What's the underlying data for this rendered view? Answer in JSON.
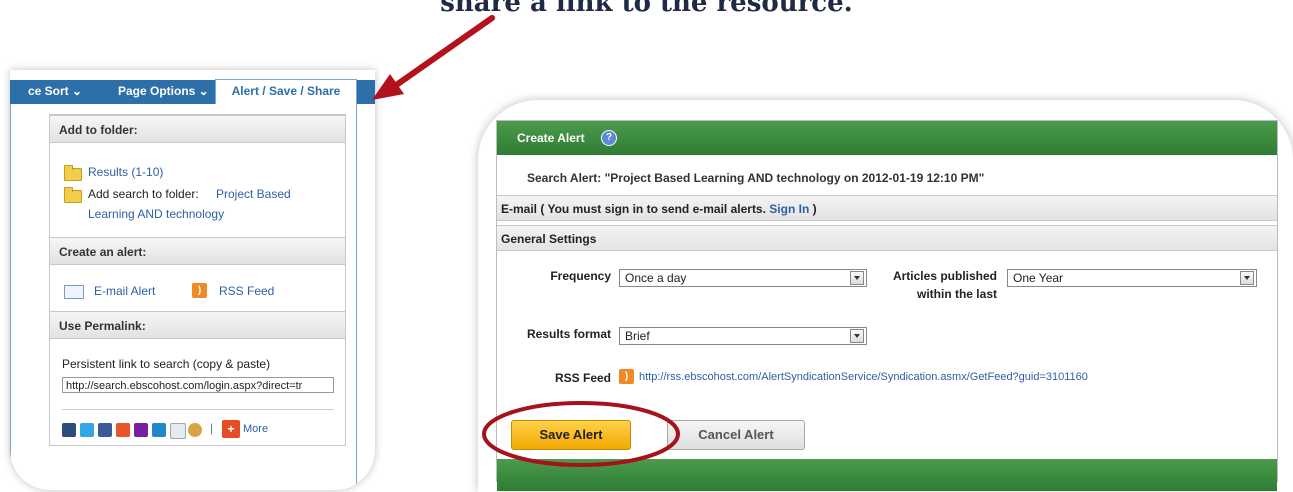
{
  "caption": "share a link to the resource.",
  "left_panel": {
    "tabs": {
      "relevance": "ce Sort ⌄",
      "page_options": "Page Options ⌄",
      "active": "Alert / Save / Share"
    },
    "add_to_folder": {
      "heading": "Add to folder:",
      "results_link": "Results (1-10)",
      "add_search_text": "Add search to folder:",
      "folder_link_line1": "Project Based",
      "folder_link_line2": "Learning AND technology"
    },
    "create_alert": {
      "heading": "Create an alert:",
      "email_label": "E-mail Alert",
      "rss_label": "RSS Feed"
    },
    "permalink": {
      "heading": "Use Permalink:",
      "label": "Persistent link to search (copy & paste)",
      "value": "http://search.ebscohost.com/login.aspx?direct=tr"
    },
    "share": {
      "more_label": "More"
    }
  },
  "right_panel": {
    "header_title": "Create Alert",
    "search_alert": "Search Alert: \"Project Based Learning AND technology on 2012-01-19 12:10 PM\"",
    "email_band_text": "E-mail ( You must sign in to send e-mail alerts.",
    "sign_in_link": "Sign In",
    "email_band_close": " )",
    "general_settings": "General Settings",
    "frequency_label": "Frequency",
    "frequency_value": "Once a day",
    "published_label_line1": "Articles published",
    "published_label_line2": "within the last",
    "published_value": "One Year",
    "results_format_label": "Results format",
    "results_format_value": "Brief",
    "rss_feed_label": "RSS Feed",
    "rss_feed_url": "http://rss.ebscohost.com/AlertSyndicationService/Syndication.asmx/GetFeed?guid=3101160",
    "save_button": "Save Alert",
    "cancel_button": "Cancel Alert"
  },
  "colors": {
    "accent_blue": "#2d6fa8",
    "green_header": "#3a8a3d",
    "save_yellow": "#f2b400",
    "annotation_red": "#b3121d"
  }
}
